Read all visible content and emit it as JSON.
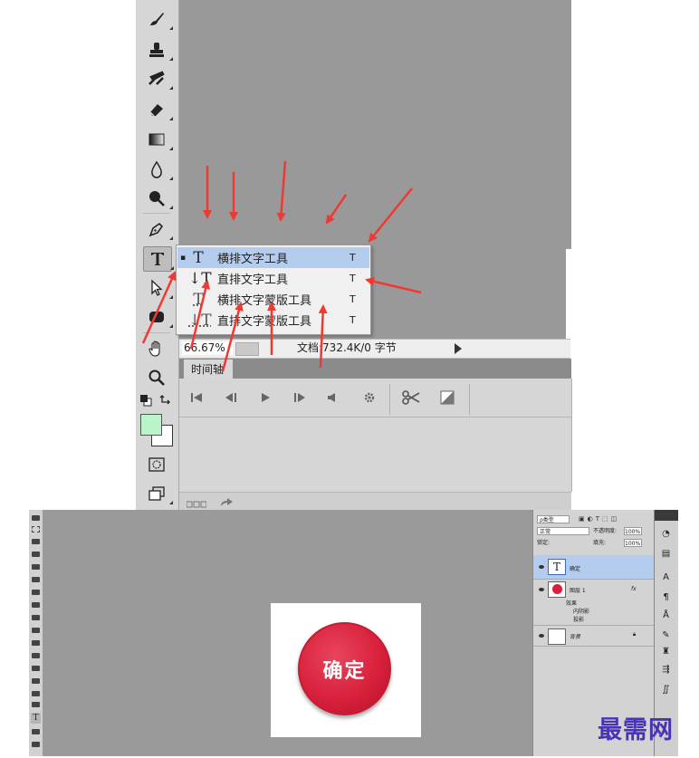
{
  "toolbar": {
    "tools": [
      "brush-tool",
      "stamp-tool",
      "history-brush-tool",
      "eraser-tool",
      "gradient-tool",
      "blur-tool",
      "dodge-tool",
      "pen-tool",
      "type-tool",
      "path-selection-tool",
      "shape-tool",
      "hand-tool",
      "zoom-tool"
    ],
    "selected": "type-tool",
    "foreground_color": "#b9f5c8",
    "background_color": "#ffffff"
  },
  "flyout": {
    "items": [
      {
        "bullet": "▪",
        "icon": "T",
        "label": "横排文字工具",
        "key": "T",
        "active": true
      },
      {
        "bullet": "",
        "icon": "↓T",
        "label": "直排文字工具",
        "key": "T",
        "active": false
      },
      {
        "bullet": "",
        "icon": "T",
        "label": "横排文字蒙版工具",
        "key": "T",
        "active": false
      },
      {
        "bullet": "",
        "icon": "↓T",
        "label": "直排文字蒙版工具",
        "key": "T",
        "active": false
      }
    ]
  },
  "status_bar": {
    "zoom": "66.67%",
    "doc_info": "文档:732.4K/0 字节"
  },
  "timeline": {
    "tab_label": "时间轴",
    "controls": [
      "first-frame-icon",
      "prev-frame-icon",
      "play-icon",
      "next-frame-icon",
      "audio-icon",
      "settings-icon",
      "scissors-icon",
      "transition-icon"
    ]
  },
  "bottom": {
    "button_text": "确定",
    "layers": {
      "kind_label": "ρ类型",
      "blend_mode": "正常",
      "opacity_label": "不透明度:",
      "opacity_value": "100%",
      "lock_label": "锁定:",
      "fill_label": "填充:",
      "fill_value": "100%",
      "rows": [
        {
          "name": "确定",
          "type": "text"
        },
        {
          "name": "图层 1",
          "type": "circle",
          "fx": "fx"
        },
        {
          "name": "效果",
          "type": "effect-header"
        },
        {
          "name": "内阴影",
          "type": "effect"
        },
        {
          "name": "投影",
          "type": "effect"
        },
        {
          "name": "背景",
          "type": "background"
        }
      ]
    },
    "accent_red": "#d9213c"
  },
  "watermark": "最需网",
  "colors": {
    "arrow_red": "#ee3a32",
    "flyout_highlight": "#b4cdef"
  }
}
